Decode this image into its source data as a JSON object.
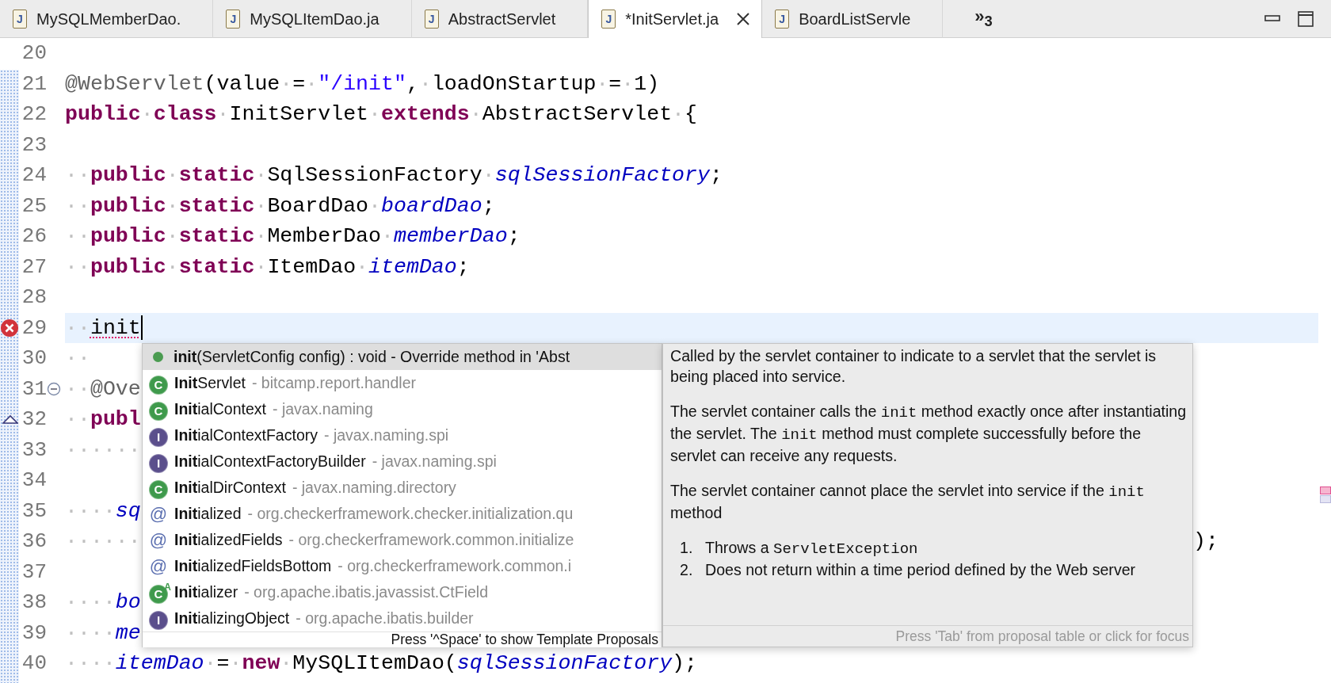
{
  "tabs": [
    {
      "label": "MySQLMemberDao.",
      "icon": "J",
      "selected": false
    },
    {
      "label": "MySQLItemDao.ja",
      "icon": "J",
      "selected": false
    },
    {
      "label": "AbstractServlet",
      "icon": "J",
      "selected": false
    },
    {
      "label": "*InitServlet.ja",
      "icon": "J",
      "selected": true
    },
    {
      "label": "BoardListServle",
      "icon": "J",
      "selected": false
    }
  ],
  "tab_overflow": "»$_{3}$",
  "editor": {
    "lines": [
      {
        "number": "20",
        "current": false
      },
      {
        "number": "21",
        "current": false,
        "code": [
          {
            "text": "@WebServlet",
            "kind": "annotation"
          },
          {
            "text": "(value",
            "kind": "plain"
          },
          {
            "text": "·",
            "kind": "ws"
          },
          {
            "text": "=",
            "kind": "plain"
          },
          {
            "text": "·",
            "kind": "ws"
          },
          {
            "text": "\"/init\"",
            "kind": "string"
          },
          {
            "text": ",",
            "kind": "plain"
          },
          {
            "text": "·",
            "kind": "ws"
          },
          {
            "text": "loadOnStartup",
            "kind": "plain"
          },
          {
            "text": "·",
            "kind": "ws"
          },
          {
            "text": "=",
            "kind": "plain"
          },
          {
            "text": "·",
            "kind": "ws"
          },
          {
            "text": "1)",
            "kind": "plain"
          }
        ]
      },
      {
        "number": "22",
        "current": false,
        "code": [
          {
            "text": "public",
            "kind": "keyword"
          },
          {
            "text": "·",
            "kind": "ws"
          },
          {
            "text": "class",
            "kind": "keyword"
          },
          {
            "text": "·",
            "kind": "ws"
          },
          {
            "text": "InitServlet",
            "kind": "plain"
          },
          {
            "text": "·",
            "kind": "ws"
          },
          {
            "text": "extends",
            "kind": "keyword"
          },
          {
            "text": "·",
            "kind": "ws"
          },
          {
            "text": "AbstractServlet",
            "kind": "plain"
          },
          {
            "text": "·",
            "kind": "ws"
          },
          {
            "text": "{",
            "kind": "plain"
          }
        ]
      },
      {
        "number": "23",
        "current": false
      },
      {
        "number": "24",
        "current": false,
        "code": [
          {
            "text": "··",
            "kind": "ws"
          },
          {
            "text": "public",
            "kind": "keyword"
          },
          {
            "text": "·",
            "kind": "ws"
          },
          {
            "text": "static",
            "kind": "keyword"
          },
          {
            "text": "·",
            "kind": "ws"
          },
          {
            "text": "SqlSessionFactory",
            "kind": "plain"
          },
          {
            "text": "·",
            "kind": "ws"
          },
          {
            "text": "sqlSessionFactory",
            "kind": "field"
          },
          {
            "text": ";",
            "kind": "plain"
          }
        ]
      },
      {
        "number": "25",
        "current": false,
        "code": [
          {
            "text": "··",
            "kind": "ws"
          },
          {
            "text": "public",
            "kind": "keyword"
          },
          {
            "text": "·",
            "kind": "ws"
          },
          {
            "text": "static",
            "kind": "keyword"
          },
          {
            "text": "·",
            "kind": "ws"
          },
          {
            "text": "BoardDao",
            "kind": "plain"
          },
          {
            "text": "·",
            "kind": "ws"
          },
          {
            "text": "boardDao",
            "kind": "field"
          },
          {
            "text": ";",
            "kind": "plain"
          }
        ]
      },
      {
        "number": "26",
        "current": false,
        "code": [
          {
            "text": "··",
            "kind": "ws"
          },
          {
            "text": "public",
            "kind": "keyword"
          },
          {
            "text": "·",
            "kind": "ws"
          },
          {
            "text": "static",
            "kind": "keyword"
          },
          {
            "text": "·",
            "kind": "ws"
          },
          {
            "text": "MemberDao",
            "kind": "plain"
          },
          {
            "text": "·",
            "kind": "ws"
          },
          {
            "text": "memberDao",
            "kind": "field"
          },
          {
            "text": ";",
            "kind": "plain"
          }
        ]
      },
      {
        "number": "27",
        "current": false,
        "code": [
          {
            "text": "··",
            "kind": "ws"
          },
          {
            "text": "public",
            "kind": "keyword"
          },
          {
            "text": "·",
            "kind": "ws"
          },
          {
            "text": "static",
            "kind": "keyword"
          },
          {
            "text": "·",
            "kind": "ws"
          },
          {
            "text": "ItemDao",
            "kind": "plain"
          },
          {
            "text": "·",
            "kind": "ws"
          },
          {
            "text": "itemDao",
            "kind": "field"
          },
          {
            "text": ";",
            "kind": "plain"
          }
        ]
      },
      {
        "number": "28",
        "current": false
      },
      {
        "number": "29",
        "current": true,
        "marker": {
          "kind": "error"
        },
        "code": [
          {
            "text": "··",
            "kind": "ws"
          },
          {
            "text": "init",
            "kind": "error"
          }
        ]
      },
      {
        "number": "30",
        "current": false,
        "code": [
          {
            "text": "··",
            "kind": "ws"
          }
        ]
      },
      {
        "number": "31",
        "current": false,
        "marker": {
          "kind": "fold"
        },
        "code": [
          {
            "text": "··",
            "kind": "ws"
          },
          {
            "text": "@Ove",
            "kind": "annotation"
          }
        ]
      },
      {
        "number": "32",
        "current": false,
        "marker": {
          "kind": "override"
        },
        "code": [
          {
            "text": "··",
            "kind": "ws"
          },
          {
            "text": "publ",
            "kind": "keyword"
          }
        ]
      },
      {
        "number": "33",
        "current": false,
        "code": [
          {
            "text": "······",
            "kind": "ws"
          }
        ]
      },
      {
        "number": "34",
        "current": false
      },
      {
        "number": "35",
        "current": false,
        "code": [
          {
            "text": "····",
            "kind": "ws"
          },
          {
            "text": "sq",
            "kind": "field"
          }
        ]
      },
      {
        "number": "36",
        "current": false,
        "code": [
          {
            "text": "······",
            "kind": "ws"
          }
        ],
        "after_popup": [
          {
            "text": ");",
            "kind": "plain"
          }
        ]
      },
      {
        "number": "37",
        "current": false
      },
      {
        "number": "38",
        "current": false,
        "code": [
          {
            "text": "····",
            "kind": "ws"
          },
          {
            "text": "bo",
            "kind": "field"
          }
        ]
      },
      {
        "number": "39",
        "current": false,
        "code": [
          {
            "text": "····",
            "kind": "ws"
          },
          {
            "text": "me",
            "kind": "field"
          }
        ]
      },
      {
        "number": "40",
        "current": false,
        "code": [
          {
            "text": "····",
            "kind": "ws"
          },
          {
            "text": "itemDao",
            "kind": "field"
          },
          {
            "text": "·",
            "kind": "ws"
          },
          {
            "text": "=",
            "kind": "plain"
          },
          {
            "text": "·",
            "kind": "ws"
          },
          {
            "text": "new",
            "kind": "keyword"
          },
          {
            "text": "·",
            "kind": "ws"
          },
          {
            "text": "MySQLItemDao(",
            "kind": "plain"
          },
          {
            "text": "sqlSessionFactory",
            "kind": "field"
          },
          {
            "text": ");",
            "kind": "plain"
          }
        ]
      }
    ]
  },
  "proposals": [
    {
      "kind": "method",
      "label": "**init**(ServletConfig config) : void - Override method in 'Abst",
      "selected": true
    },
    {
      "kind": "class",
      "icon": "C",
      "label": "**Init**Servlet",
      "qualifier": "- bitcamp.report.handler",
      "selected": false
    },
    {
      "kind": "class",
      "icon": "C",
      "label": "**Init**ialContext",
      "qualifier": "- javax.naming",
      "selected": false
    },
    {
      "kind": "interface",
      "icon": "I",
      "label": "**Init**ialContextFactory",
      "qualifier": "- javax.naming.spi",
      "selected": false
    },
    {
      "kind": "interface",
      "icon": "I",
      "label": "**Init**ialContextFactoryBuilder",
      "qualifier": "- javax.naming.spi",
      "selected": false
    },
    {
      "kind": "class",
      "icon": "C",
      "label": "**Init**ialDirContext",
      "qualifier": "- javax.naming.directory",
      "selected": false
    },
    {
      "kind": "annotation",
      "icon": "@",
      "label": "**Init**ialized",
      "qualifier": "- org.checkerframework.checker.initialization.qu",
      "selected": false
    },
    {
      "kind": "annotation",
      "icon": "@",
      "label": "**Init**ializedFields",
      "qualifier": "- org.checkerframework.common.initialize",
      "selected": false
    },
    {
      "kind": "annotation",
      "icon": "@",
      "label": "**Init**ializedFieldsBottom",
      "qualifier": "- org.checkerframework.common.i",
      "selected": false
    },
    {
      "kind": "abstract_class",
      "icon": "C",
      "badge": "A",
      "label": "**Init**ializer",
      "qualifier": "- org.apache.ibatis.javassist.CtField",
      "selected": false
    },
    {
      "kind": "interface",
      "icon": "I",
      "label": "**Init**ializingObject",
      "qualifier": "- org.apache.ibatis.builder",
      "selected": false
    }
  ],
  "proposal_hint": "Press '^Space' to show Template Proposals",
  "documentation": {
    "paragraphs": [
      [
        {
          "text": "Called by the servlet container to indicate to a servlet that the servlet is being placed into service."
        }
      ],
      [
        {
          "text": "The servlet container calls the "
        },
        {
          "text": "init",
          "kind": "code"
        },
        {
          "text": " method exactly once after instantiating the servlet. The "
        },
        {
          "text": "init",
          "kind": "code"
        },
        {
          "text": " method must complete successfully before the servlet can receive any requests."
        }
      ],
      [
        {
          "text": "The servlet container cannot place the servlet into service if the "
        },
        {
          "text": "init",
          "kind": "code"
        },
        {
          "text": " method"
        }
      ]
    ],
    "list": [
      {
        "number": "1.",
        "segments": [
          {
            "text": "Throws a "
          },
          {
            "text": "ServletException",
            "kind": "code"
          }
        ]
      },
      {
        "number": "2.",
        "segments": [
          {
            "text": "Does not return within a time period defined by the Web server"
          }
        ]
      }
    ],
    "footer": "Press 'Tab' from proposal table or click for focus"
  }
}
